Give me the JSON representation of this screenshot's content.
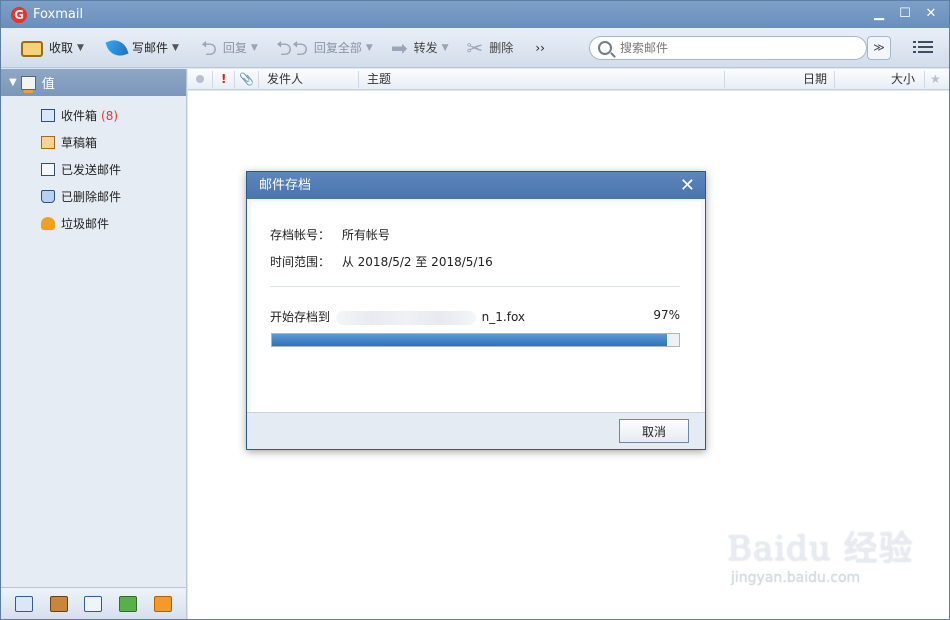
{
  "window": {
    "title": "Foxmail",
    "logo_letter": "G"
  },
  "toolbar": {
    "receive": "收取",
    "compose": "写邮件",
    "reply": "回复",
    "reply_all": "回复全部",
    "forward": "转发",
    "delete": "删除",
    "more": "››"
  },
  "search": {
    "placeholder": "搜索邮件",
    "options_glyph": "≫"
  },
  "sidebar": {
    "account": "值",
    "folders": [
      {
        "label": "收件箱",
        "count": "(8)"
      },
      {
        "label": "草稿箱"
      },
      {
        "label": "已发送邮件"
      },
      {
        "label": "已删除邮件"
      },
      {
        "label": "垃圾邮件"
      }
    ]
  },
  "list_header": {
    "sender": "发件人",
    "subject": "主题",
    "date": "日期",
    "size": "大小",
    "priority_glyph": "!",
    "star_glyph": "★"
  },
  "dialog": {
    "title": "邮件存档",
    "account_label": "存档帐号：",
    "account_value": "所有帐号",
    "range_label": "时间范围：",
    "range_value": "从 2018/5/2 至 2018/5/16",
    "progress_prefix": "开始存档到",
    "progress_file": "n_1.fox",
    "progress_percent_text": "97%",
    "progress_fraction": 0.97,
    "cancel": "取消"
  },
  "watermark": {
    "line1": "Baidu 经验",
    "line2": "jingyan.baidu.com"
  }
}
